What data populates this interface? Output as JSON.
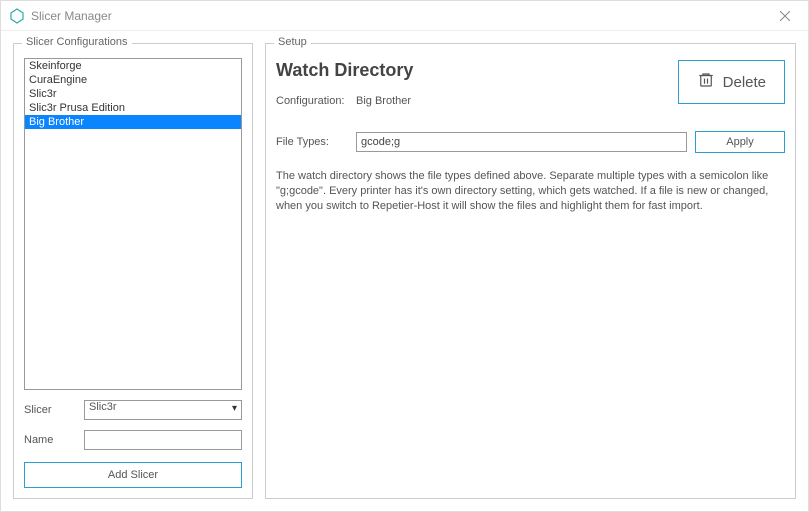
{
  "window": {
    "title": "Slicer Manager"
  },
  "left": {
    "legend": "Slicer Configurations",
    "items": [
      {
        "label": "Skeinforge",
        "selected": false
      },
      {
        "label": "CuraEngine",
        "selected": false
      },
      {
        "label": "Slic3r",
        "selected": false
      },
      {
        "label": "Slic3r Prusa Edition",
        "selected": false
      },
      {
        "label": "Big Brother",
        "selected": true
      }
    ],
    "slicer_label": "Slicer",
    "slicer_value": "Slic3r",
    "name_label": "Name",
    "name_value": "",
    "add_button": "Add Slicer"
  },
  "right": {
    "legend": "Setup",
    "title": "Watch Directory",
    "delete_label": "Delete",
    "configuration_label": "Configuration:",
    "configuration_value": "Big Brother",
    "filetypes_label": "File Types:",
    "filetypes_value": "gcode;g",
    "apply_label": "Apply",
    "help": "The watch directory shows the file types defined above. Separate multiple types with a semicolon like \"g;gcode\". Every printer has it's own directory setting, which gets watched. If a file is new or changed, when you switch to Repetier-Host it will show the files and highlight them for fast import."
  }
}
